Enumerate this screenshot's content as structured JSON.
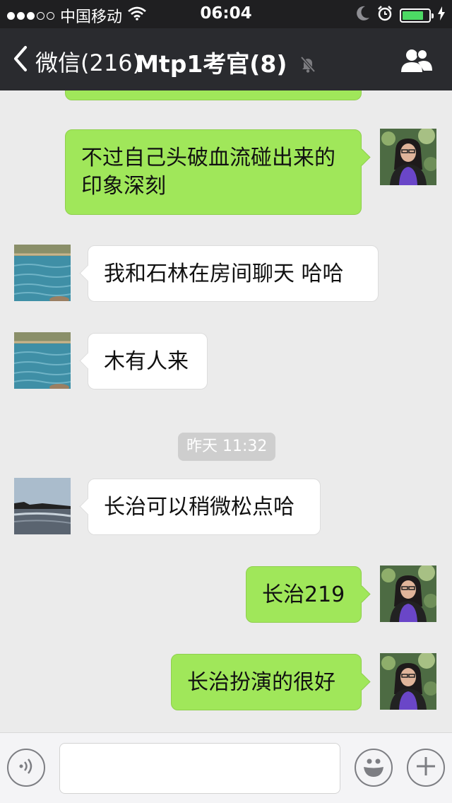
{
  "status_bar": {
    "carrier": "中国移动",
    "time": "06:04",
    "signal_bars_filled": 3,
    "signal_bars_total": 5,
    "battery_level": 0.8,
    "icons": [
      "wifi-icon",
      "moon-icon",
      "alarm-icon",
      "battery-icon",
      "charging-icon"
    ]
  },
  "nav": {
    "back_label": "微信(216)",
    "title": "Mtp1考官(8)",
    "icons": [
      "chevron-left-icon",
      "mute-bell-icon",
      "group-members-icon"
    ]
  },
  "messages": [
    {
      "side": "me",
      "text": "",
      "partial": true
    },
    {
      "side": "me",
      "text": "不过自己头破血流碰出来的印象深刻"
    },
    {
      "side": "them",
      "text": "我和石林在房间聊天  哈哈"
    },
    {
      "side": "them",
      "text": "木有人来"
    },
    {
      "side": "them",
      "text": "长治可以稍微松点哈"
    },
    {
      "side": "me",
      "text": "长治219"
    },
    {
      "side": "me",
      "text": "长治扮演的很好"
    }
  ],
  "timestamp": "昨天 11:32",
  "input_bar": {
    "icons": [
      "voice-icon",
      "emoji-icon",
      "plus-icon"
    ],
    "placeholder": ""
  },
  "colors": {
    "my_bubble": "#a0e75a",
    "their_bubble": "#ffffff",
    "chat_background": "#ebebeb",
    "nav_background": "#2a2b2f",
    "battery_fill": "#4cd964"
  }
}
